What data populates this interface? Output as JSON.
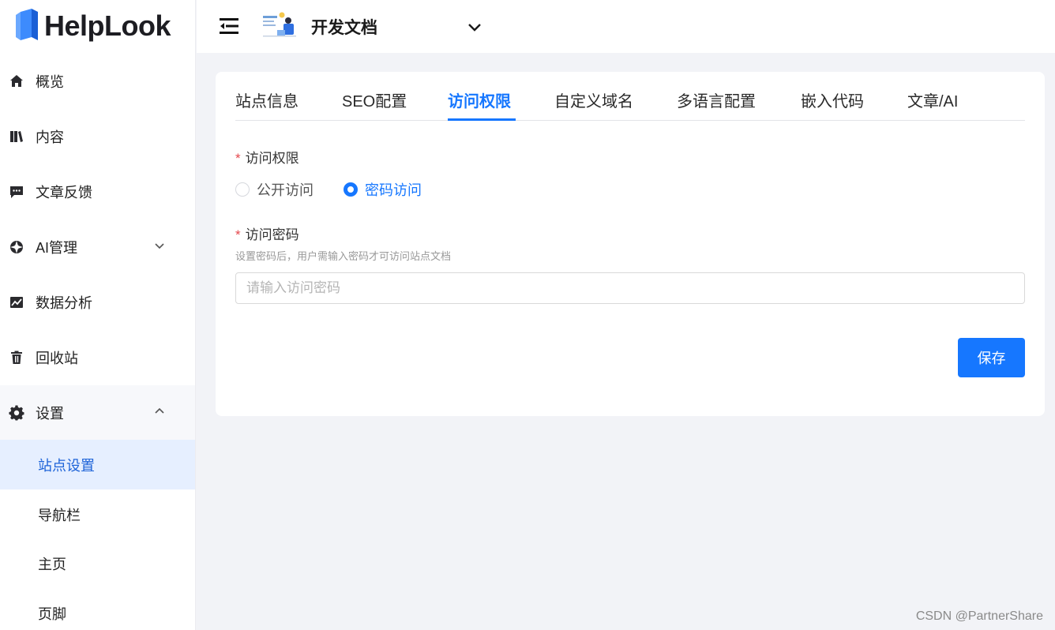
{
  "app": {
    "name": "HelpLook"
  },
  "sidebar": {
    "items": [
      {
        "label": "概览",
        "icon": "home-icon"
      },
      {
        "label": "内容",
        "icon": "books-icon"
      },
      {
        "label": "文章反馈",
        "icon": "comment-icon"
      },
      {
        "label": "AI管理",
        "icon": "ai-icon",
        "expand": "chevron-down-icon"
      },
      {
        "label": "数据分析",
        "icon": "chart-icon"
      },
      {
        "label": "回收站",
        "icon": "trash-icon"
      },
      {
        "label": "设置",
        "icon": "gear-icon",
        "expand": "chevron-up-icon"
      }
    ],
    "sub_items": [
      {
        "label": "站点设置",
        "active": true
      },
      {
        "label": "导航栏"
      },
      {
        "label": "主页"
      },
      {
        "label": "页脚"
      }
    ]
  },
  "header": {
    "doc_title": "开发文档"
  },
  "tabs": [
    {
      "label": "站点信息"
    },
    {
      "label": "SEO配置"
    },
    {
      "label": "访问权限",
      "active": true
    },
    {
      "label": "自定义域名"
    },
    {
      "label": "多语言配置"
    },
    {
      "label": "嵌入代码"
    },
    {
      "label": "文章/AI"
    }
  ],
  "form": {
    "access": {
      "label": "访问权限",
      "required_mark": "*",
      "options": [
        {
          "label": "公开访问",
          "checked": false
        },
        {
          "label": "密码访问",
          "checked": true
        }
      ]
    },
    "password": {
      "label": "访问密码",
      "required_mark": "*",
      "hint": "设置密码后，用户需输入密码才可访问站点文档",
      "value": "",
      "placeholder": "请输入访问密码"
    },
    "save_label": "保存"
  },
  "watermark": "CSDN @PartnerShare",
  "colors": {
    "accent": "#1677ff",
    "required": "#e5484d",
    "active_bg": "#e6efff"
  }
}
